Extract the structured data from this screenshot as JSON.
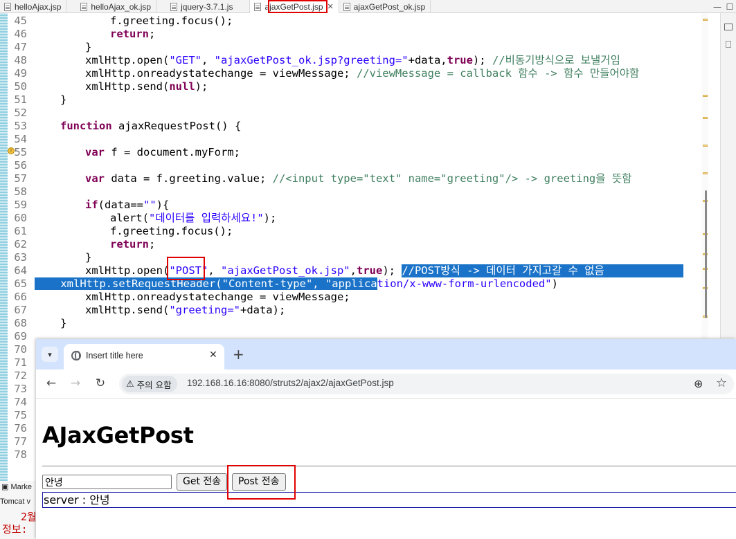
{
  "editor": {
    "tabs": [
      {
        "label": "helloAjax.jsp"
      },
      {
        "label": "helloAjax_ok.jsp"
      },
      {
        "label": "jquery-3.7.1.js"
      },
      {
        "label": "ajaxGetPost.jsp",
        "active": true
      },
      {
        "label": "ajaxGetPost_ok.jsp"
      }
    ],
    "line_numbers": [
      "45",
      "46",
      "47",
      "48",
      "49",
      "50",
      "51",
      "52",
      "53",
      "54",
      "55",
      "56",
      "57",
      "58",
      "59",
      "60",
      "61",
      "62",
      "63",
      "64",
      "65",
      "66",
      "67",
      "68",
      "69",
      "70",
      "71",
      "72",
      "73",
      "74",
      "75",
      "76",
      "77",
      "78"
    ],
    "code": {
      "l45_a": "f.greeting.focus();",
      "l46_kw": "return",
      "l46_b": ";",
      "l47": "}",
      "l48_a": "xmlHttp.open(",
      "l48_s1": "\"GET\"",
      "l48_b": ", ",
      "l48_s2": "\"ajaxGetPost_ok.jsp?greeting=\"",
      "l48_c": "+data,",
      "l48_kw": "true",
      "l48_d": "); ",
      "l48_cm": "//비동기방식으로 보낼거임",
      "l49_a": "xmlHttp.onreadystatechange = viewMessage; ",
      "l49_cm": "//viewMessage = callback 함수 -> 함수 만들어야함",
      "l50_a": "xmlHttp.send(",
      "l50_kw": "null",
      "l50_b": ");",
      "l51": "}",
      "l53_kw": "function",
      "l53_a": " ajaxRequestPost() {",
      "l55_kw": "var",
      "l55_a": " f = document.myForm;",
      "l57_kw": "var",
      "l57_a": " data = f.greeting.value; ",
      "l57_cm": "//<input type=\"text\" name=\"greeting\"/> -> greeting을 뜻함",
      "l59_kw": "if",
      "l59_a": "(data==",
      "l59_s": "\"\"",
      "l59_b": "){",
      "l60_a": "alert(",
      "l60_s": "\"데이터를 입력하세요!\"",
      "l60_b": ");",
      "l61_a": "f.greeting.focus();",
      "l62_kw": "return",
      "l62_b": ";",
      "l63": "}",
      "l64_a": "xmlHttp.open(",
      "l64_s1": "\"POST\"",
      "l64_b": ", ",
      "l64_s2": "\"ajaxGetPost_ok.jsp\"",
      "l64_c": ",",
      "l64_kw": "true",
      "l64_d": "); ",
      "l64_cm": "//POST방식 -> 데이터 가지고갈 수 없음",
      "l65_a": "xmlHttp.setRequestHeader(",
      "l65_s1": "\"Content-type\"",
      "l65_b": ", ",
      "l65_s2a": "\"applica",
      "l65_s2b": "tion/x-www-form-urlencoded\"",
      "l65_c": ")",
      "l66_a": "xmlHttp.onreadystatechange = viewMessage;",
      "l67_a": "xmlHttp.send(",
      "l67_s": "\"greeting=\"",
      "l67_b": "+data);",
      "l68": "}"
    }
  },
  "console": {
    "tab_label": "Marke",
    "server_label": "Tomcat v",
    "line1": "2월",
    "line2": "정보:"
  },
  "browser": {
    "tab_title": "Insert title here",
    "security_label": "주의 요함",
    "url": "192.168.16.16:8080/struts2/ajax2/ajaxGetPost.jsp",
    "page": {
      "heading": "AJaxGetPost",
      "input_value": "안녕",
      "get_button": "Get 전송",
      "post_button": "Post 전송",
      "result": "server : 안녕"
    }
  }
}
